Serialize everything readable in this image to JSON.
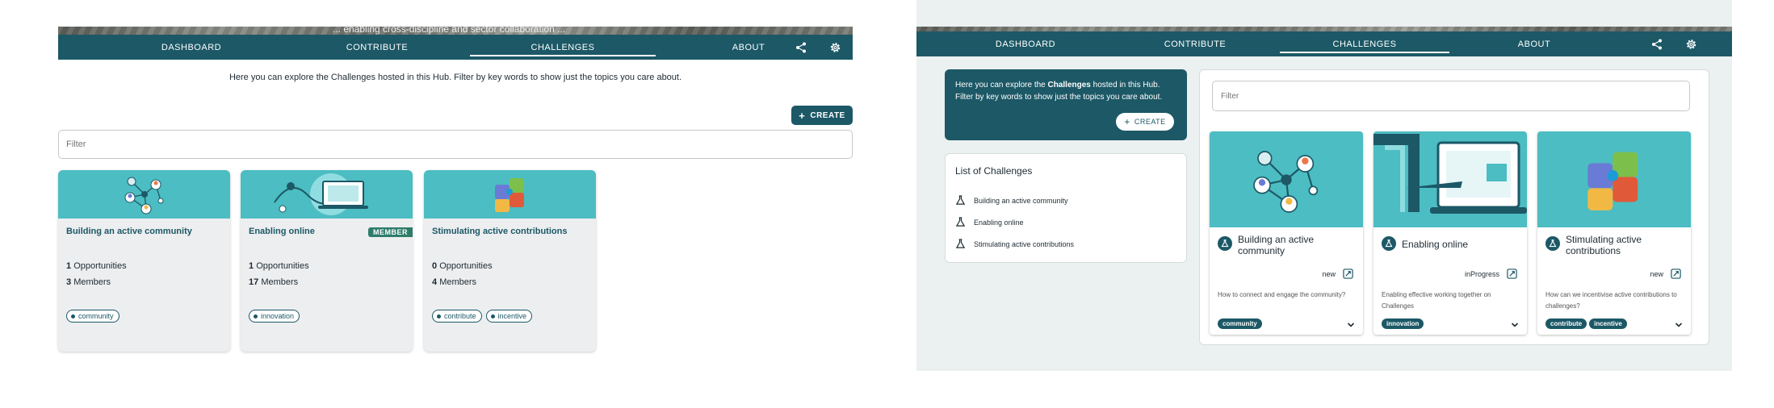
{
  "left": {
    "banner_text": "... enabling cross-discipline and sector collaboration ...",
    "nav": {
      "items": [
        {
          "label": "DASHBOARD"
        },
        {
          "label": "CONTRIBUTE"
        },
        {
          "label": "CHALLENGES"
        },
        {
          "label": "ABOUT"
        }
      ],
      "active": "CHALLENGES",
      "icons": [
        "share-icon",
        "gear-icon"
      ]
    },
    "intro": "Here you can explore the Challenges hosted in this Hub. Filter by key words to show just the topics you care about.",
    "create_label": "CREATE",
    "filter_placeholder": "Filter",
    "cards": [
      {
        "title": "Building an active community",
        "opportunities_count": "1",
        "opportunities_label": "Opportunities",
        "members_count": "3",
        "members_label": "Members",
        "tags": [
          "community"
        ],
        "badge": ""
      },
      {
        "title": "Enabling online",
        "opportunities_count": "1",
        "opportunities_label": "Opportunities",
        "members_count": "17",
        "members_label": "Members",
        "tags": [
          "innovation"
        ],
        "badge": "MEMBER"
      },
      {
        "title": "Stimulating active contributions",
        "opportunities_count": "0",
        "opportunities_label": "Opportunities",
        "members_count": "4",
        "members_label": "Members",
        "tags": [
          "contribute",
          "incentive"
        ],
        "badge": ""
      }
    ]
  },
  "right": {
    "nav": {
      "items": [
        {
          "label": "DASHBOARD"
        },
        {
          "label": "CONTRIBUTE"
        },
        {
          "label": "CHALLENGES"
        },
        {
          "label": "ABOUT"
        }
      ],
      "active": "CHALLENGES",
      "icons": [
        "share-icon",
        "gear-icon"
      ]
    },
    "intro": {
      "before": "Here you can explore the ",
      "bold": "Challenges",
      "after": " hosted in this Hub. Filter by key words to show just the topics you care about."
    },
    "create_label": "CREATE",
    "list_title": "List of Challenges",
    "list_items": [
      "Building an active community",
      "Enabling online",
      "Stimulating active contributions"
    ],
    "filter_placeholder": "Filter",
    "cards": [
      {
        "title": "Building an active community",
        "status": "new",
        "description": "How to connect and engage the community?",
        "tags": [
          "community"
        ]
      },
      {
        "title": "Enabling online",
        "status": "inProgress",
        "description": "Enabling effective working together on Challenges",
        "tags": [
          "innovation"
        ]
      },
      {
        "title": "Stimulating active contributions",
        "status": "new",
        "description": "How can we incentivise active contributions to challenges?",
        "tags": [
          "contribute",
          "incentive"
        ]
      }
    ]
  },
  "colors": {
    "brand_dark": "#1c5866",
    "card_image_bg": "#4cbdc2",
    "page_bg_right": "#ebf0f0",
    "member_badge": "#2e7d6b"
  }
}
